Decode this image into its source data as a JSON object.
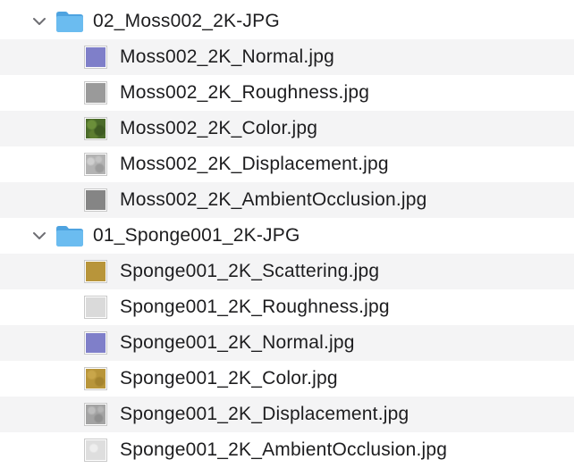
{
  "rows": [
    {
      "kind": "folder",
      "label": "02_Moss002_2K-JPG",
      "expanded": true,
      "icon": "folder-icon"
    },
    {
      "kind": "file",
      "label": "Moss002_2K_Normal.jpg",
      "thumb": "normal-map",
      "color": "#7f7fc9"
    },
    {
      "kind": "file",
      "label": "Moss002_2K_Roughness.jpg",
      "thumb": "roughness-map",
      "color": "#9a9a9a"
    },
    {
      "kind": "file",
      "label": "Moss002_2K_Color.jpg",
      "thumb": "moss-color",
      "color": "#4b6b2a"
    },
    {
      "kind": "file",
      "label": "Moss002_2K_Displacement.jpg",
      "thumb": "displacement-map",
      "color": "#b3b3b3"
    },
    {
      "kind": "file",
      "label": "Moss002_2K_AmbientOcclusion.jpg",
      "thumb": "ao-map",
      "color": "#8a8a8a"
    },
    {
      "kind": "folder",
      "label": "01_Sponge001_2K-JPG",
      "expanded": true,
      "icon": "folder-icon"
    },
    {
      "kind": "file",
      "label": "Sponge001_2K_Scattering.jpg",
      "thumb": "scattering-map",
      "color": "#b8953a"
    },
    {
      "kind": "file",
      "label": "Sponge001_2K_Roughness.jpg",
      "thumb": "roughness-map",
      "color": "#d8d8d8"
    },
    {
      "kind": "file",
      "label": "Sponge001_2K_Normal.jpg",
      "thumb": "normal-map",
      "color": "#7f7fc9"
    },
    {
      "kind": "file",
      "label": "Sponge001_2K_Color.jpg",
      "thumb": "sponge-color",
      "color": "#b8953a"
    },
    {
      "kind": "file",
      "label": "Sponge001_2K_Displacement.jpg",
      "thumb": "displacement-map",
      "color": "#a6a6a6"
    },
    {
      "kind": "file",
      "label": "Sponge001_2K_AmbientOcclusion.jpg",
      "thumb": "ao-map",
      "color": "#e0e0e0"
    }
  ],
  "colors": {
    "folder": "#5aaee8",
    "folder_tab": "#7cc2f0",
    "stripe": "#f4f4f5",
    "text": "#1d1d1f",
    "chevron": "#6e6e73"
  }
}
